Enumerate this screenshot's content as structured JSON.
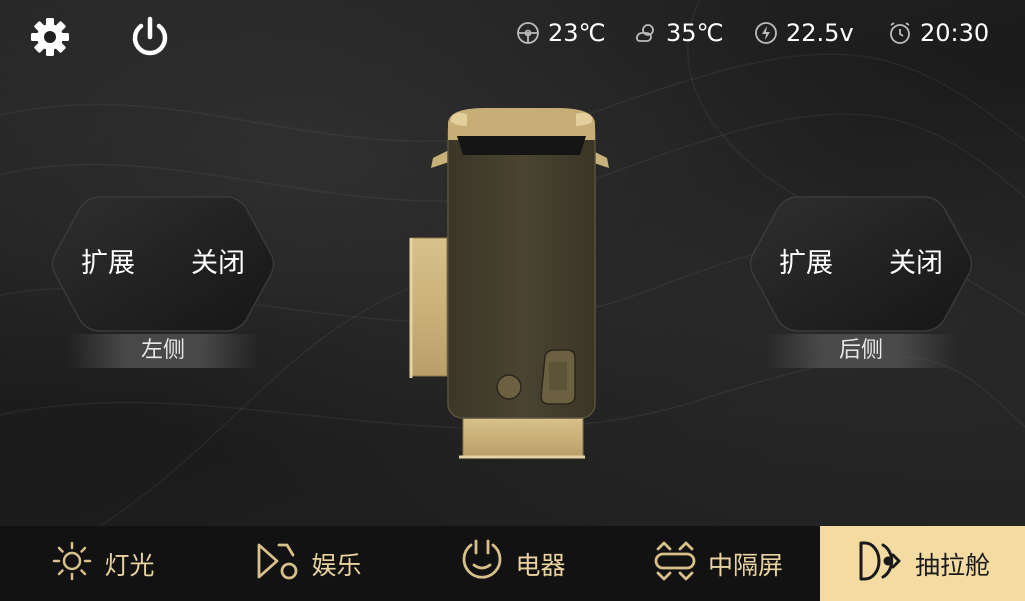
{
  "topbar": {
    "icons": [
      "gear-icon",
      "power-icon"
    ],
    "status": [
      {
        "icon": "steering-wheel-icon",
        "value": "23℃"
      },
      {
        "icon": "sun-cloud-icon",
        "value": "35℃"
      },
      {
        "icon": "battery-bolt-icon",
        "value": "22.5v"
      },
      {
        "icon": "alarm-clock-icon",
        "value": "20:30"
      }
    ]
  },
  "left_panel": {
    "expand_label": "扩展",
    "close_label": "关闭",
    "caption": "左侧"
  },
  "right_panel": {
    "expand_label": "扩展",
    "close_label": "关闭",
    "caption": "后侧"
  },
  "nav": {
    "items": [
      {
        "label": "灯光",
        "icon": "sun-icon"
      },
      {
        "label": "娱乐",
        "icon": "music-note-icon"
      },
      {
        "label": "电器",
        "icon": "power-socket-icon"
      },
      {
        "label": "中隔屏",
        "icon": "partition-screen-icon"
      },
      {
        "label": "抽拉舱",
        "icon": "slide-out-cabin-icon",
        "active": true
      }
    ]
  },
  "colors": {
    "accent": "#f3dba2",
    "gold": "#d8c08a",
    "background": "#1c1c1c",
    "nav_background": "#121212"
  }
}
